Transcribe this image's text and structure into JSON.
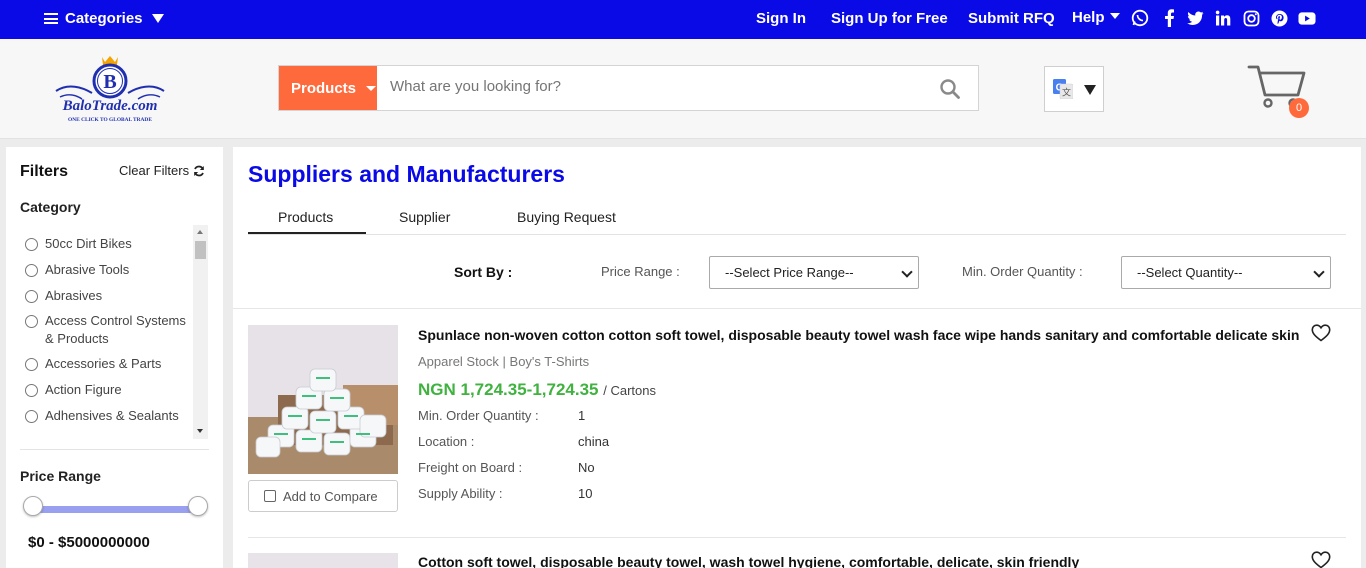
{
  "topbar": {
    "categories_label": "Categories",
    "links": {
      "sign_in": "Sign In",
      "sign_up": "Sign Up for Free",
      "submit_rfq": "Submit RFQ",
      "help": "Help"
    },
    "social_icons": [
      "whatsapp-icon",
      "facebook-icon",
      "twitter-icon",
      "linkedin-icon",
      "instagram-icon",
      "pinterest-icon",
      "youtube-icon"
    ],
    "bg_color": "#0a0ae6"
  },
  "header": {
    "logo": {
      "brand": "BaloTrade.com",
      "tagline": "ONE CLICK TO GLOBAL TRADE",
      "letter": "B"
    },
    "search": {
      "scope_label": "Products",
      "placeholder": "What are you looking for?"
    },
    "cart_count": "0",
    "accent_color": "#ff6a3d"
  },
  "sidebar": {
    "filters_title": "Filters",
    "clear_filters": "Clear Filters",
    "category_title": "Category",
    "categories": [
      "50cc Dirt Bikes",
      "Abrasive Tools",
      "Abrasives",
      "Access Control Systems & Products",
      "Accessories & Parts",
      "Action Figure",
      "Adhensives & Sealants"
    ],
    "price_range_title": "Price Range",
    "price_range_value": "$0 - $5000000000"
  },
  "main": {
    "heading": "Suppliers and Manufacturers",
    "tabs": [
      {
        "label": "Products",
        "active": true
      },
      {
        "label": "Supplier",
        "active": false
      },
      {
        "label": "Buying Request",
        "active": false
      }
    ],
    "sort_by_label": "Sort By :",
    "price_range_label": "Price Range :",
    "price_range_select": "--Select Price Range--",
    "min_order_label": "Min. Order Quantity :",
    "min_order_select": "--Select Quantity--",
    "products": [
      {
        "title": "Spunlace non-woven cotton cotton soft towel, disposable beauty towel wash face wipe hands sanitary and comfortable delicate skin",
        "category": "Apparel Stock | Boy's T-Shirts",
        "price": "NGN 1,724.35-1,724.35",
        "unit": "/ Cartons",
        "compare_label": "Add to Compare",
        "details": [
          {
            "key": "Min. Order Quantity :",
            "value": "1"
          },
          {
            "key": "Location :",
            "value": "china"
          },
          {
            "key": "Freight on Board :",
            "value": "No"
          },
          {
            "key": "Supply Ability :",
            "value": "10"
          }
        ]
      },
      {
        "title": "Cotton soft towel, disposable beauty towel, wash towel hygiene, comfortable, delicate, skin friendly"
      }
    ],
    "price_color": "#3fb23f"
  }
}
